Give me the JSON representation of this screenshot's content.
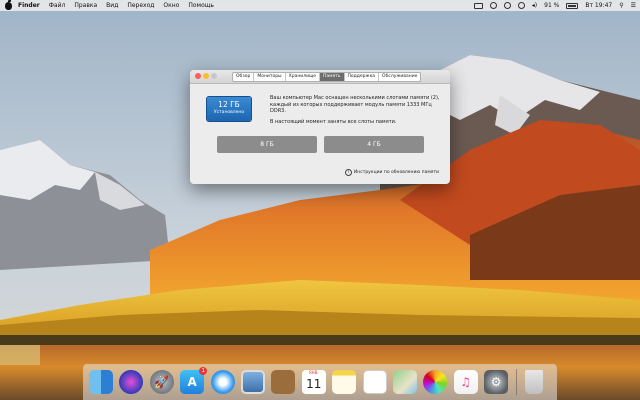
{
  "menubar": {
    "app_name": "Finder",
    "items": [
      "Файл",
      "Правка",
      "Вид",
      "Переход",
      "Окно",
      "Помощь"
    ],
    "battery": "91 %",
    "clock": "Вт 19:47"
  },
  "window": {
    "tabs": [
      "Обзор",
      "Мониторы",
      "Хранилище",
      "Память",
      "Поддержка",
      "Обслуживание"
    ],
    "active_tab": "Память",
    "memory": {
      "total": "12 ГБ",
      "status": "Установлено"
    },
    "description_1": "Ваш компьютер Mac оснащен несколькими слотами памяти (2), каждый из которых поддерживает модуль памяти 1333 МГц DDR3.",
    "description_2": "В настоящий момент заняты все слоты памяти.",
    "slots": [
      "8 ГБ",
      "4 ГБ"
    ],
    "help_link": "Инструкции по обновлению памяти"
  },
  "dock": {
    "icons": [
      "finder-icon",
      "siri-icon",
      "launchpad-icon",
      "app-store-icon",
      "safari-icon",
      "preview-icon",
      "notes-book-icon",
      "calendar-icon",
      "notes-icon",
      "reminders-icon",
      "maps-icon",
      "photos-icon",
      "music-icon",
      "system-preferences-icon",
      "trash-icon"
    ],
    "app_store_badge": "1",
    "calendar": {
      "month": "ЯНВ.",
      "day": "11"
    }
  },
  "colors": {
    "accent": "#2a78c2",
    "slot_gray": "#8c8c8c",
    "close": "#fc5f57",
    "minimize": "#fdbc2e"
  }
}
